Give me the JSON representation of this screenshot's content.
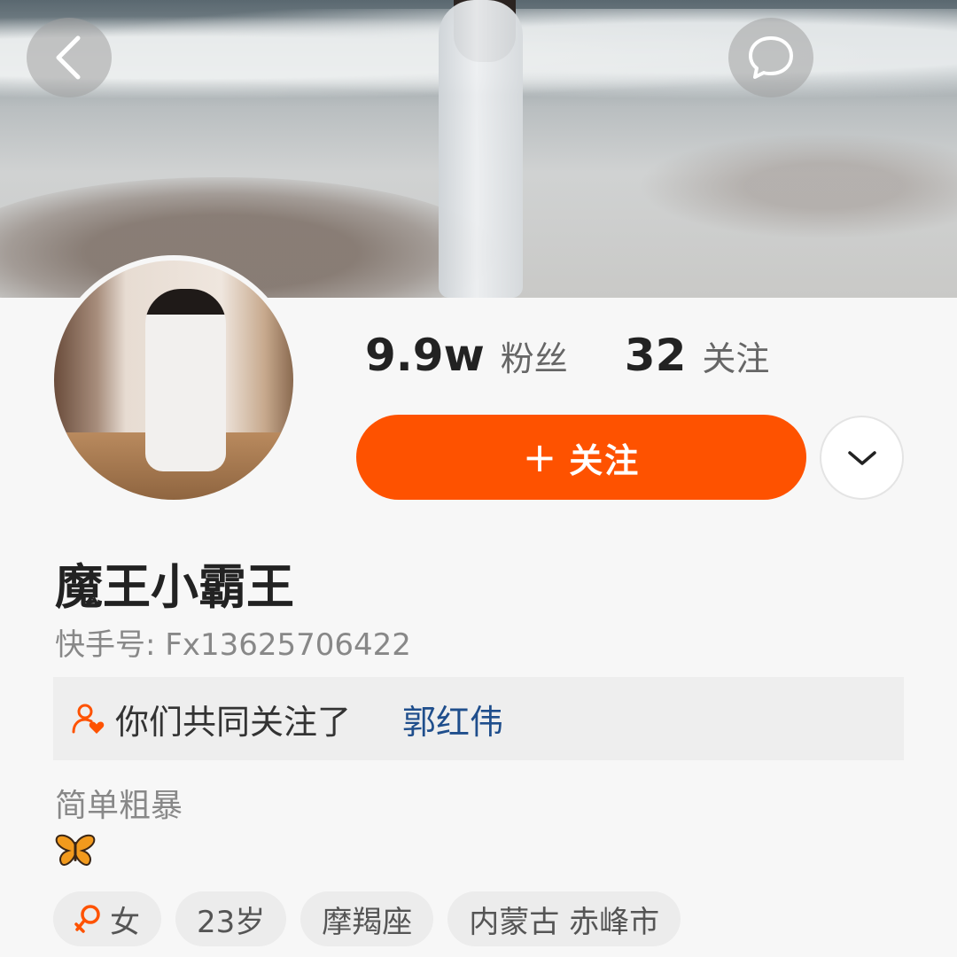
{
  "header": {
    "back_icon": "chevron-left-icon",
    "message_icon": "chat-bubble-icon",
    "share_icon": "wechat-icon",
    "share_color": "#20c160"
  },
  "stats": {
    "followers_value": "9.9w",
    "followers_label": "粉丝",
    "following_value": "32",
    "following_label": "关注"
  },
  "follow_button": {
    "plus": "+",
    "label": "关注",
    "color": "#fe5200"
  },
  "more_icon": "chevron-down-icon",
  "profile": {
    "nickname": "魔王小霸王",
    "kuaishou_id": "快手号: Fx13625706422"
  },
  "mutual": {
    "text": "你们共同关注了",
    "name": "郭红伟",
    "icon": "mutual-follow-icon"
  },
  "bio": {
    "text": "简单粗暴",
    "emoji": "butterfly-icon"
  },
  "tags": [
    "女",
    "23岁",
    "摩羯座",
    "内蒙古 赤峰市"
  ],
  "tag_icons": {
    "gender": "female-icon"
  }
}
